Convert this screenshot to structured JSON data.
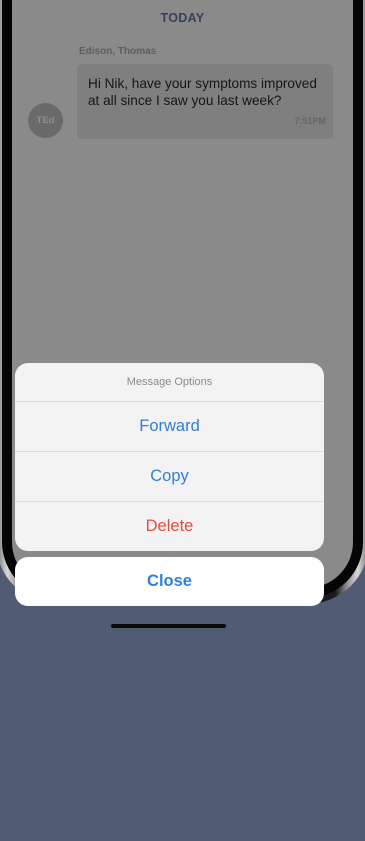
{
  "chat": {
    "date_header": "TODAY",
    "message": {
      "sender": "Edison, Thomas",
      "avatar_initials": "TEd",
      "text": "Hi Nik, have your symptoms improved at all since I saw you last week?",
      "time": "7:51PM"
    }
  },
  "action_sheet": {
    "title": "Message Options",
    "options": [
      {
        "label": "Forward"
      },
      {
        "label": "Copy"
      },
      {
        "label": "Delete"
      }
    ],
    "close_label": "Close"
  },
  "colors": {
    "accent": "#2f7ed8",
    "destructive": "#e74c3c",
    "background": "#525b74"
  }
}
